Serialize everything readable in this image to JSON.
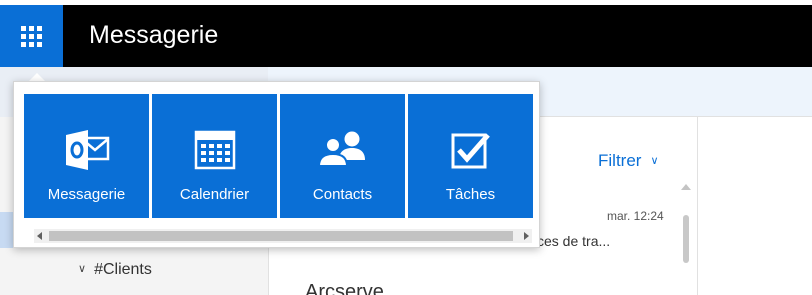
{
  "header": {
    "app_title": "Messagerie",
    "launcher_icon": "waffle-icon",
    "bar_color": "#000000",
    "accent_color": "#0a6fd6"
  },
  "launcher": {
    "tiles": [
      {
        "label": "Messagerie",
        "icon": "outlook-icon"
      },
      {
        "label": "Calendrier",
        "icon": "calendar-icon"
      },
      {
        "label": "Contacts",
        "icon": "people-icon"
      },
      {
        "label": "Tâches",
        "icon": "task-check-icon"
      }
    ]
  },
  "folders": {
    "items": [
      {
        "label": "#Clients",
        "expanded": true
      }
    ]
  },
  "message_list": {
    "filter_label": "Filtrer",
    "messages": [
      {
        "time": "mar. 12:24",
        "preview": "ces de tra..."
      },
      {
        "sender": "Arcserve"
      }
    ]
  }
}
